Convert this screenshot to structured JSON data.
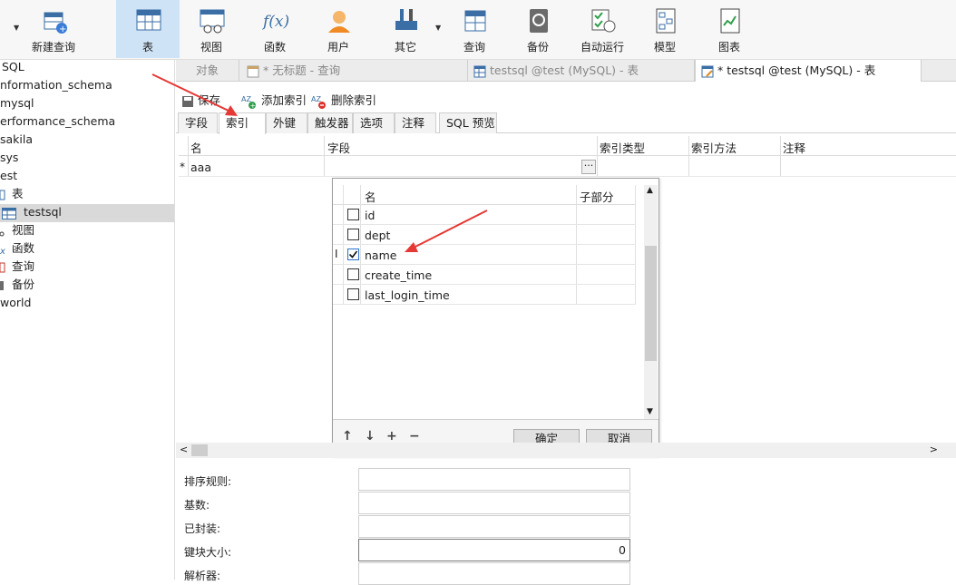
{
  "toolbar": {
    "items": [
      {
        "label": "新建查询",
        "icon": "new-query-icon"
      },
      {
        "label": "表",
        "icon": "table-icon"
      },
      {
        "label": "视图",
        "icon": "view-icon"
      },
      {
        "label": "函数",
        "icon": "function-icon"
      },
      {
        "label": "用户",
        "icon": "user-icon"
      },
      {
        "label": "其它",
        "icon": "tools-icon"
      },
      {
        "label": "查询",
        "icon": "query-icon"
      },
      {
        "label": "备份",
        "icon": "backup-icon"
      },
      {
        "label": "自动运行",
        "icon": "schedule-icon"
      },
      {
        "label": "模型",
        "icon": "model-icon"
      },
      {
        "label": "图表",
        "icon": "chart-icon"
      }
    ],
    "fx_glyph": "f(x)"
  },
  "tree": {
    "items": [
      "SQL",
      "nformation_schema",
      "mysql",
      "erformance_schema",
      "sakila",
      "sys",
      "est",
      "表",
      "testsql",
      "视图",
      "函数",
      "查询",
      "备份",
      "world"
    ]
  },
  "doc_tabs": [
    "对象",
    "* 无标题 - 查询",
    "testsql @test (MySQL) - 表",
    "* testsql @test (MySQL) - 表"
  ],
  "actions": {
    "save": "保存",
    "add_index": "添加索引",
    "delete_index": "删除索引"
  },
  "sub_tabs": [
    "字段",
    "索引",
    "外键",
    "触发器",
    "选项",
    "注释",
    "SQL 预览"
  ],
  "grid": {
    "columns": [
      "名",
      "字段",
      "索引类型",
      "索引方法",
      "注释"
    ],
    "row_marker": "*",
    "row_name": "aaa",
    "ellipsis": "···"
  },
  "popup": {
    "columns": [
      "名",
      "子部分"
    ],
    "fields": [
      {
        "name": "id",
        "checked": false
      },
      {
        "name": "dept",
        "checked": false
      },
      {
        "name": "name",
        "checked": true
      },
      {
        "name": "create_time",
        "checked": false
      },
      {
        "name": "last_login_time",
        "checked": false
      }
    ],
    "ok": "确定",
    "cancel": "取消",
    "move_up": "↑",
    "move_down": "↓",
    "add": "+",
    "remove": "−"
  },
  "props": [
    {
      "label": "排序规则:",
      "value": ""
    },
    {
      "label": "基数:",
      "value": ""
    },
    {
      "label": "已封装:",
      "value": ""
    },
    {
      "label": "键块大小:",
      "value": "0"
    },
    {
      "label": "解析器:",
      "value": ""
    }
  ],
  "colors": {
    "accent": "#2a6fc9",
    "arrow": "#e53935",
    "selected_tab": "#cfe3f6"
  }
}
